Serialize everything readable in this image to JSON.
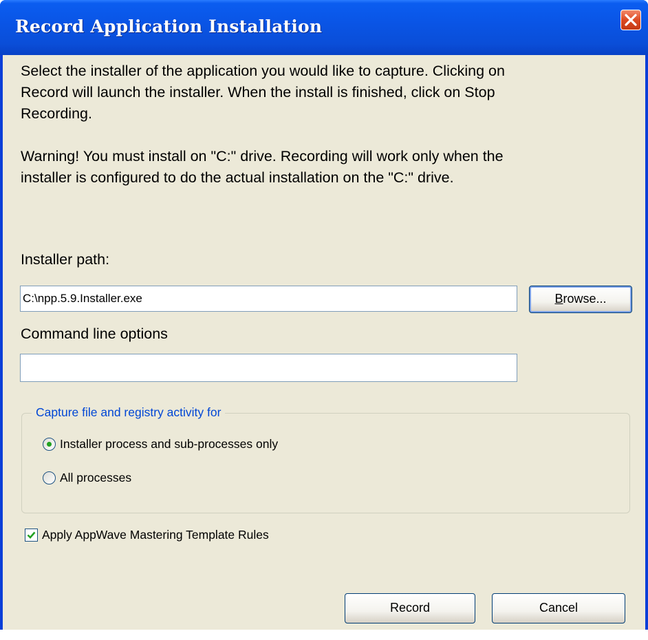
{
  "window": {
    "title": "Record Application Installation"
  },
  "instructions": {
    "line1": "Select the installer of the application you would like to capture.  Clicking on",
    "line2": "Record will  launch the installer.  When the install is finished, click on Stop",
    "line3": "Recording.",
    "warning1": "Warning! You must install on \"C:\" drive. Recording will work only when the",
    "warning2": "installer is configured to do the actual installation on the \"C:\" drive."
  },
  "installer_path": {
    "label": "Installer path:",
    "value": "C:\\npp.5.9.Installer.exe",
    "browse_label": "Browse...",
    "browse_accel": "B",
    "browse_rest": "rowse..."
  },
  "command_line": {
    "label": "Command line options",
    "value": ""
  },
  "capture_group": {
    "legend": "Capture file and registry activity for",
    "options": [
      {
        "label": "Installer process and sub-processes only",
        "selected": true
      },
      {
        "label": "All processes",
        "selected": false
      }
    ]
  },
  "apply_rules": {
    "label": "Apply AppWave Mastering Template Rules",
    "checked": true
  },
  "buttons": {
    "record": "Record",
    "cancel": "Cancel"
  },
  "colors": {
    "title_bar": "#0a4ed8",
    "dialog_face": "#ece9d8",
    "group_legend": "#0046d5",
    "close_button": "#dc4a22"
  }
}
